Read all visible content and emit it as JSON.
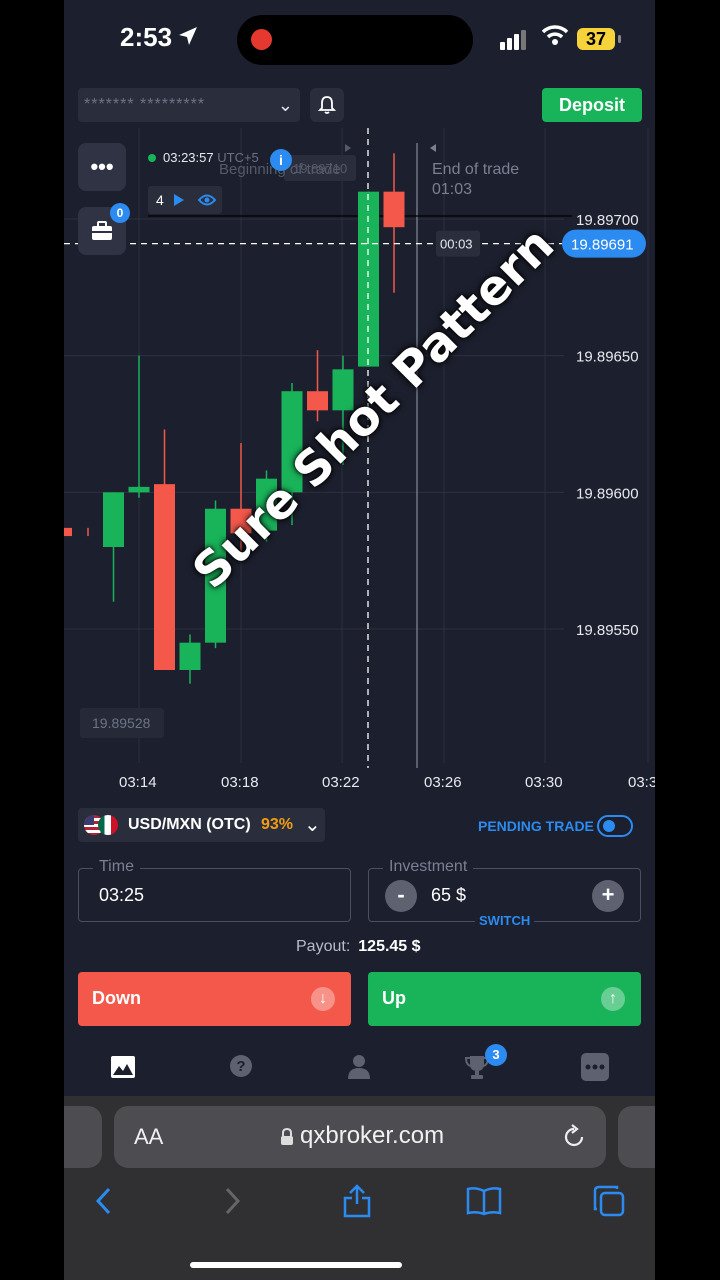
{
  "status_bar": {
    "time": "2:53",
    "battery": "37"
  },
  "header": {
    "account_masked": "******* *********",
    "deposit_label": "Deposit"
  },
  "chart_overlay": {
    "clock": "03:23:57",
    "timezone": "UTC+5",
    "beginning_label": "Beginning of trade",
    "end_label": "End of trade",
    "end_time": "01:03",
    "countdown": "00:03",
    "trade_count": "4",
    "briefcase_badge": "0",
    "min_price_label": "19.89528",
    "faded_price_label": "19.89710"
  },
  "chart_data": {
    "type": "candlestick",
    "title": "",
    "y_ticks": [
      "19.89700",
      "19.89650",
      "19.89600",
      "19.89550"
    ],
    "x_ticks": [
      "03:14",
      "03:18",
      "03:22",
      "03:26",
      "03:30",
      "03:3"
    ],
    "current_price": "19.89691",
    "ylim": [
      19.8952,
      19.8974
    ],
    "candles": [
      {
        "o": 19.89584,
        "c": 19.89587,
        "h": 19.89587,
        "l": 19.89584,
        "color": "red"
      },
      {
        "o": 19.8958,
        "c": 19.896,
        "h": 19.896,
        "l": 19.8956,
        "color": "green"
      },
      {
        "o": 19.896,
        "c": 19.89602,
        "h": 19.8965,
        "l": 19.89598,
        "color": "green"
      },
      {
        "o": 19.89603,
        "c": 19.89535,
        "h": 19.89623,
        "l": 19.89535,
        "color": "red"
      },
      {
        "o": 19.89535,
        "c": 19.89545,
        "h": 19.89548,
        "l": 19.8953,
        "color": "green"
      },
      {
        "o": 19.89545,
        "c": 19.89594,
        "h": 19.89597,
        "l": 19.89543,
        "color": "green"
      },
      {
        "o": 19.89594,
        "c": 19.89585,
        "h": 19.89618,
        "l": 19.89576,
        "color": "red"
      },
      {
        "o": 19.89586,
        "c": 19.89605,
        "h": 19.89608,
        "l": 19.89582,
        "color": "green"
      },
      {
        "o": 19.896,
        "c": 19.89637,
        "h": 19.8964,
        "l": 19.89588,
        "color": "green"
      },
      {
        "o": 19.89637,
        "c": 19.8963,
        "h": 19.89652,
        "l": 19.89626,
        "color": "red"
      },
      {
        "o": 19.8963,
        "c": 19.89645,
        "h": 19.8965,
        "l": 19.8961,
        "color": "green"
      },
      {
        "o": 19.89646,
        "c": 19.8971,
        "h": 19.8971,
        "l": 19.89646,
        "color": "green"
      },
      {
        "o": 19.8971,
        "c": 19.89697,
        "h": 19.89724,
        "l": 19.89673,
        "color": "red"
      }
    ]
  },
  "watermark": "Sure Shot Pattern",
  "asset": {
    "pair": "USD/MXN (OTC)",
    "payout_pct": "93%"
  },
  "pending_trade_label": "PENDING TRADE",
  "time_field": {
    "label": "Time",
    "value": "03:25"
  },
  "investment_field": {
    "label": "Investment",
    "value": "65 $",
    "minus": "-",
    "plus": "+",
    "switch_label": "SWITCH"
  },
  "payout": {
    "label": "Payout:",
    "value": "125.45 $"
  },
  "buttons": {
    "down": "Down",
    "up": "Up"
  },
  "tabbar": {
    "trophy_badge": "3"
  },
  "safari": {
    "aa": "AA",
    "domain": "qxbroker.com"
  },
  "colors": {
    "green": "#19b45a",
    "red": "#f3584a",
    "blue": "#2b8bf0",
    "bg": "#1c1f2d"
  }
}
